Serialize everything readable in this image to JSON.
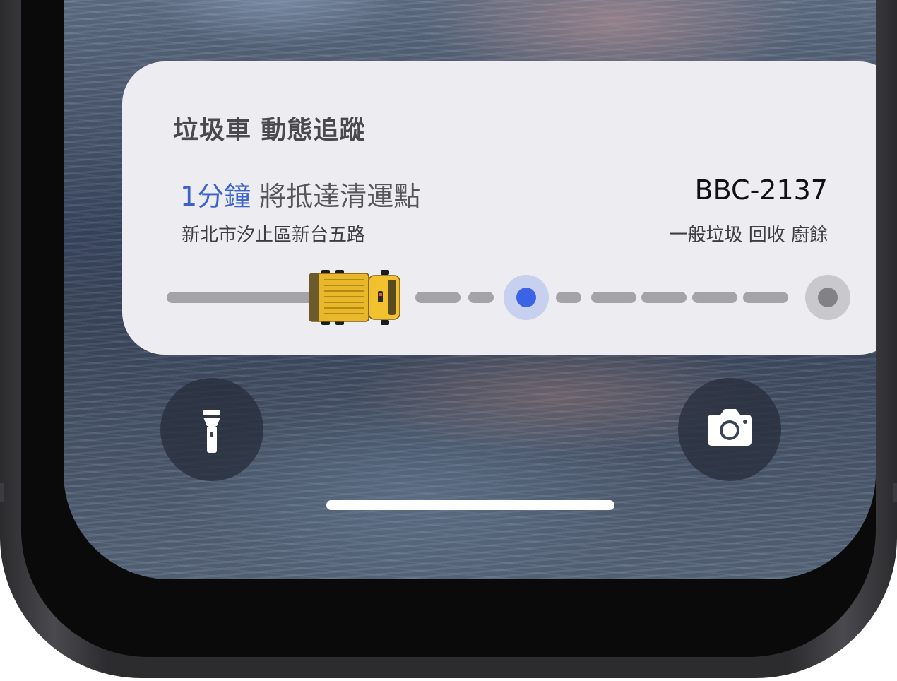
{
  "live_activity": {
    "title": "垃圾車 動態追蹤",
    "eta_minutes": "1分鐘",
    "eta_text": " 將抵達清運點",
    "plate_number": "BBC-2137",
    "address": "新北市汐止區新台五路",
    "waste_types": "一般垃圾 回收 廚餘",
    "accent_color": "#3b63e6",
    "route": {
      "truck_icon": "garbage-truck-icon",
      "current_stop_icon": "current-stop-dot",
      "end_stop_icon": "final-stop-dot"
    }
  },
  "lock_screen": {
    "flashlight_icon": "flashlight-icon",
    "camera_icon": "camera-icon"
  }
}
